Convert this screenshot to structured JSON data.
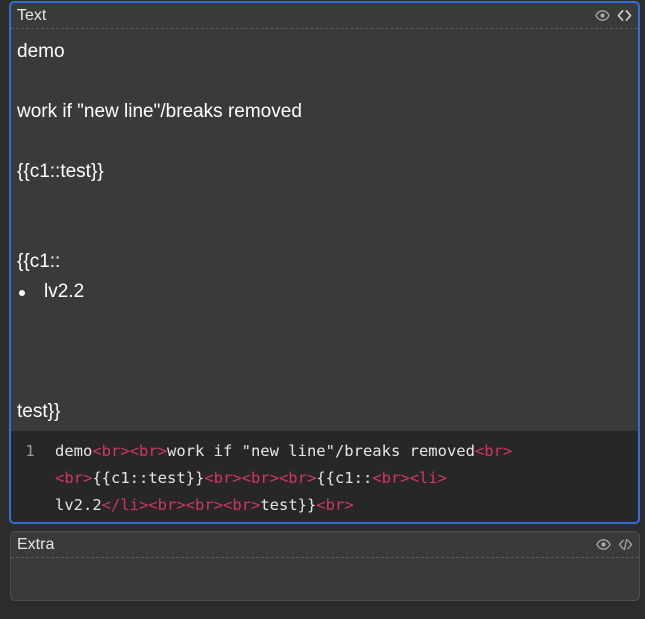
{
  "fields": {
    "text": {
      "label": "Text",
      "icons": [
        "eye-icon",
        "code-icon"
      ],
      "rich_lines": [
        "demo",
        "",
        "work if \"new line\"/breaks removed",
        "",
        "{{c1::test}}",
        "",
        "",
        "{{c1::"
      ],
      "list_item": "lv2.2",
      "after_list_lines": [
        "",
        "",
        "",
        "test}}"
      ],
      "code": {
        "line_number": "1",
        "segments": [
          [
            {
              "t": "txt",
              "v": "demo"
            },
            {
              "t": "tag",
              "v": "<br>"
            },
            {
              "t": "tag",
              "v": "<br>"
            },
            {
              "t": "txt",
              "v": "work if \"new line\"/breaks removed"
            },
            {
              "t": "tag",
              "v": "<br>"
            }
          ],
          [
            {
              "t": "tag",
              "v": "<br>"
            },
            {
              "t": "txt",
              "v": "{{c1::test}}"
            },
            {
              "t": "tag",
              "v": "<br>"
            },
            {
              "t": "tag",
              "v": "<br>"
            },
            {
              "t": "tag",
              "v": "<br>"
            },
            {
              "t": "txt",
              "v": "{{c1::"
            },
            {
              "t": "tag",
              "v": "<br>"
            },
            {
              "t": "tag",
              "v": "<li>"
            }
          ],
          [
            {
              "t": "txt",
              "v": "lv2.2"
            },
            {
              "t": "tag",
              "v": "</li>"
            },
            {
              "t": "tag",
              "v": "<br>"
            },
            {
              "t": "tag",
              "v": "<br>"
            },
            {
              "t": "tag",
              "v": "<br>"
            },
            {
              "t": "txt",
              "v": "test}}"
            },
            {
              "t": "tag",
              "v": "<br>"
            }
          ]
        ]
      }
    },
    "extra": {
      "label": "Extra",
      "icons": [
        "eye-icon",
        "code-icon"
      ]
    }
  },
  "colors": {
    "background": "#2c2c2c",
    "field_bg": "#3a3a3a",
    "focus_border": "#2f6fd6",
    "code_bg": "#272727",
    "tag_color": "#d1375c",
    "text_color": "#ffffff"
  }
}
